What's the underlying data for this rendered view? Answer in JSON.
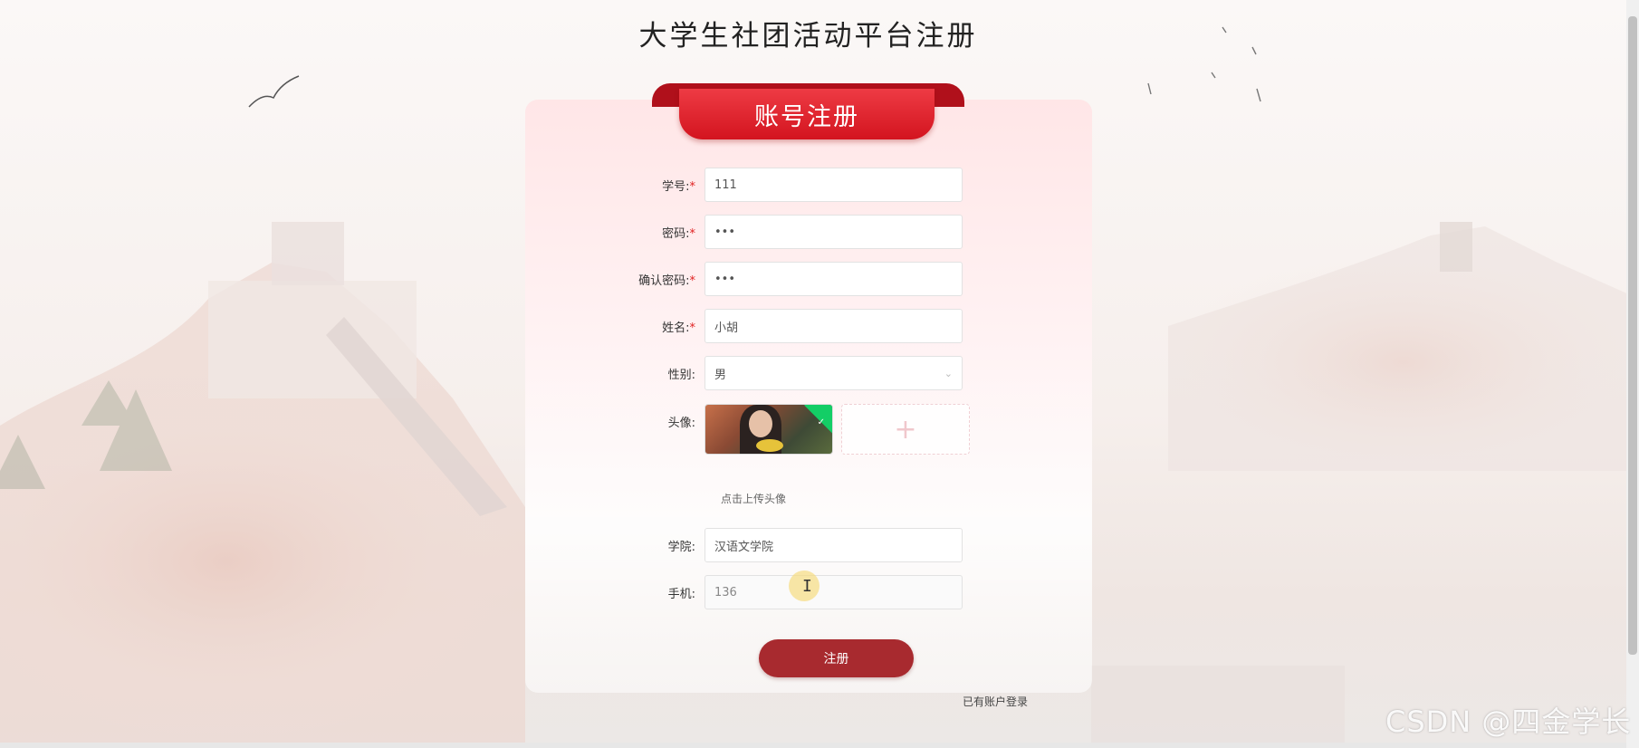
{
  "page": {
    "title": "大学生社团活动平台注册"
  },
  "card": {
    "heading": "账号注册"
  },
  "form": {
    "student_id": {
      "label": "学号:",
      "value": "111"
    },
    "password": {
      "label": "密码:",
      "value": "•••"
    },
    "confirm_password": {
      "label": "确认密码:",
      "value": "•••"
    },
    "name": {
      "label": "姓名:",
      "value": "小胡"
    },
    "gender": {
      "label": "性别:",
      "value": "男",
      "icon": "chevron-down-icon"
    },
    "avatar": {
      "label": "头像:",
      "hint": "点击上传头像",
      "upload_icon": "plus-icon"
    },
    "college": {
      "label": "学院:",
      "value": "汉语文学院"
    },
    "phone": {
      "label": "手机:",
      "value": "136"
    },
    "required_mark": "*"
  },
  "actions": {
    "submit_label": "注册",
    "login_link": "已有账户登录"
  },
  "watermark": "CSDN @四金学长"
}
